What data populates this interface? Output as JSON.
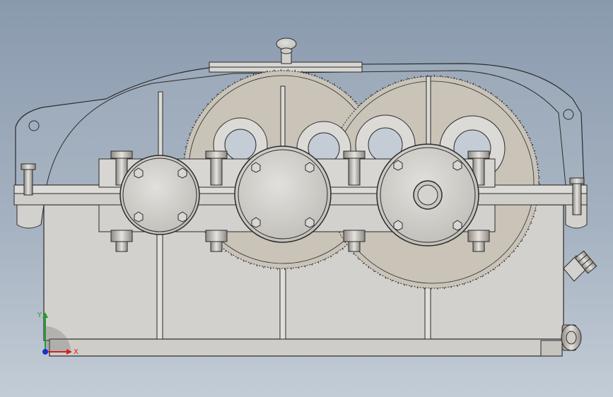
{
  "viewport": {
    "background_top": "#8a9aae",
    "background_bottom": "#c3ccd6",
    "part_color": "#d6d4d0",
    "gear_color": "#c9c3b8",
    "edge_color": "#2b2b2b"
  },
  "triad": {
    "x_label": "X",
    "y_label": "Y",
    "x_color": "#d62020",
    "y_color": "#1fa02a",
    "z_color": "#1a2fd6"
  }
}
